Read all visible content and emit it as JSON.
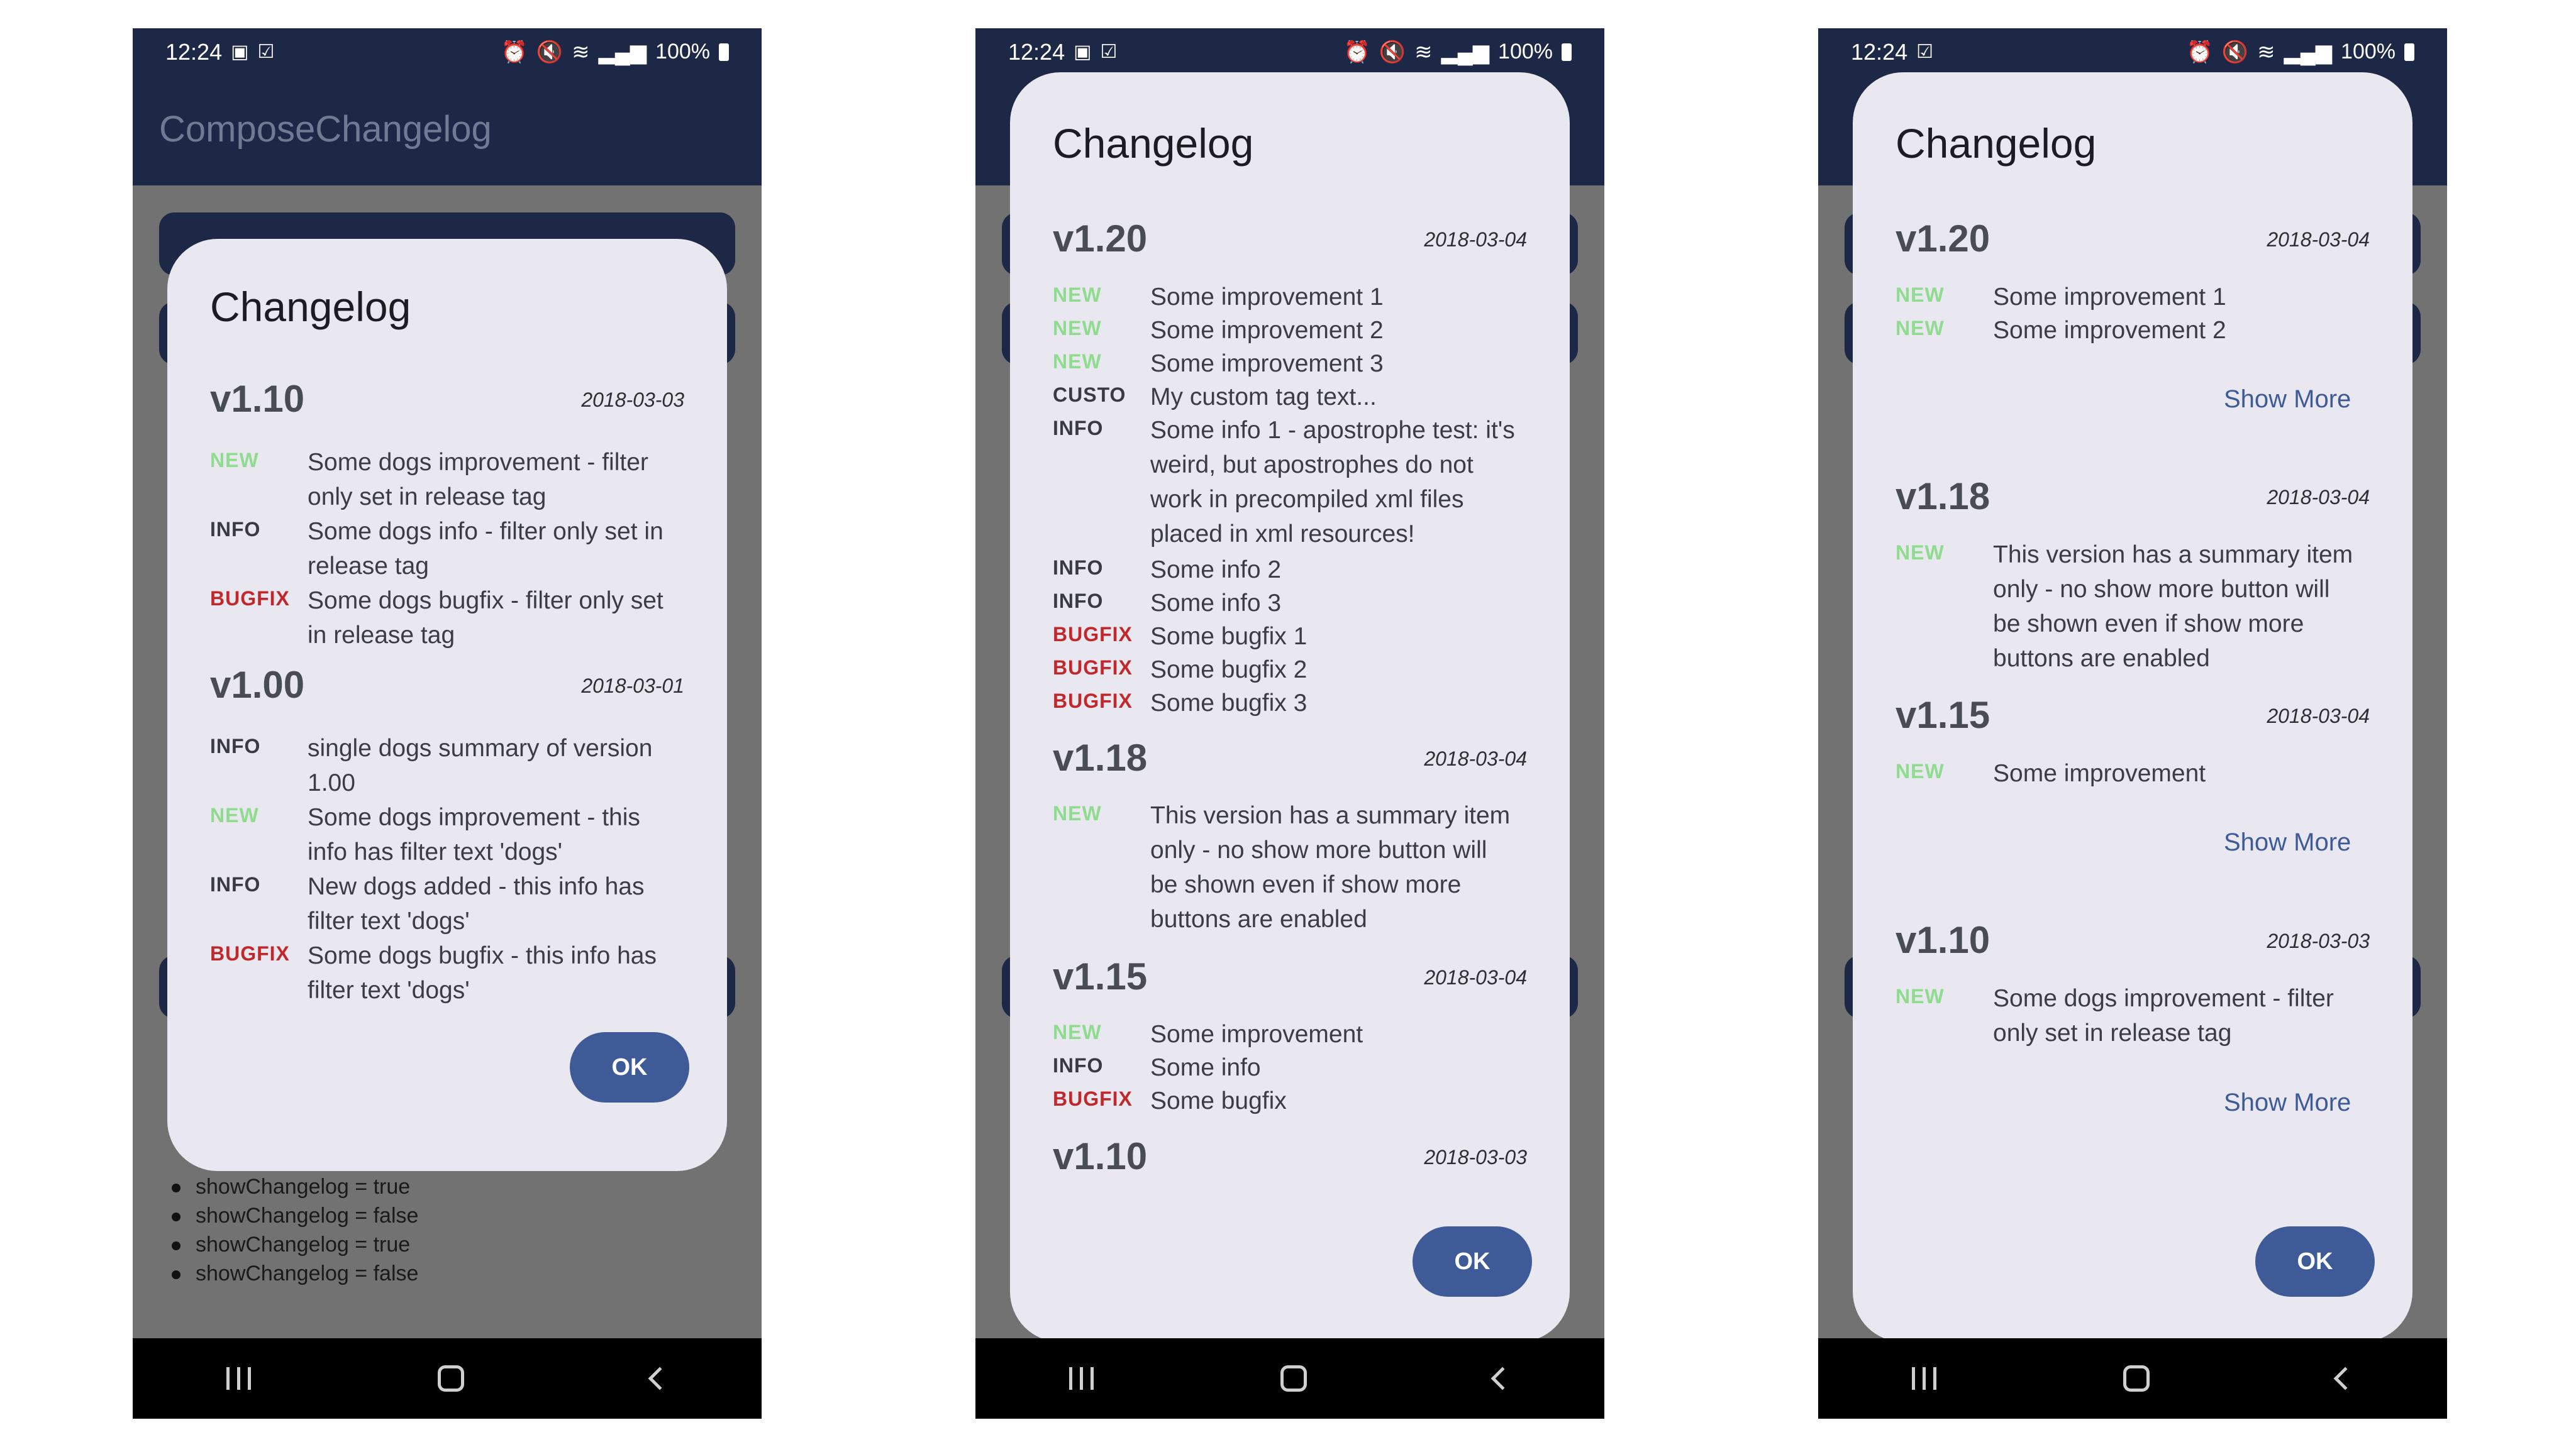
{
  "status": {
    "time": "12:24",
    "battery": "100%"
  },
  "screen1": {
    "app_title": "ComposeChangelog",
    "bg_items": [
      "showChangelog = true",
      "showChangelog = false",
      "showChangelog = true",
      "showChangelog = false"
    ],
    "dialog": {
      "title": "Changelog",
      "versions": [
        {
          "name": "v1.10",
          "date": "2018-03-03",
          "items": [
            {
              "tag": "NEW",
              "line1": "Some dogs improvement - filter",
              "line2": "only set in release tag"
            },
            {
              "tag": "INFO",
              "line1": "Some dogs info - filter only set in",
              "line2": "release tag"
            },
            {
              "tag": "BUGFIX",
              "line1": "Some dogs bugfix - filter only set",
              "line2": "in release tag"
            }
          ]
        },
        {
          "name": "v1.00",
          "date": "2018-03-01",
          "items": [
            {
              "tag": "INFO",
              "line1": "single dogs summary of version",
              "line2": "1.00"
            },
            {
              "tag": "NEW",
              "line1": "Some dogs improvement - this",
              "line2": "info has filter text 'dogs'"
            },
            {
              "tag": "INFO",
              "line1": "New dogs added - this info has",
              "line2": "filter text 'dogs'"
            },
            {
              "tag": "BUGFIX",
              "line1": "Some dogs bugfix - this info has",
              "line2": "filter text 'dogs'"
            }
          ]
        }
      ],
      "ok_label": "OK"
    }
  },
  "screen2": {
    "dialog": {
      "title": "Changelog",
      "v120": {
        "name": "v1.20",
        "date": "2018-03-04",
        "items": [
          {
            "tag": "NEW",
            "text": "Some improvement 1"
          },
          {
            "tag": "NEW",
            "text": "Some improvement 2"
          },
          {
            "tag": "NEW",
            "text": "Some improvement 3"
          },
          {
            "tag": "CUSTO",
            "text": "My custom tag text..."
          },
          {
            "tag": "INFO",
            "line1": "Some info 1 - apostrophe test: it's",
            "line2": "weird, but apostrophes do not",
            "line3": "work in precompiled xml files",
            "line4": "placed in xml resources!"
          },
          {
            "tag": "INFO",
            "text": "Some info 2"
          },
          {
            "tag": "INFO",
            "text": "Some info 3"
          },
          {
            "tag": "BUGFIX",
            "text": "Some bugfix 1"
          },
          {
            "tag": "BUGFIX",
            "text": "Some bugfix 2"
          },
          {
            "tag": "BUGFIX",
            "text": "Some bugfix 3"
          }
        ]
      },
      "v118": {
        "name": "v1.18",
        "date": "2018-03-04",
        "items": [
          {
            "tag": "NEW",
            "line1": "This version has a summary item",
            "line2": "only - no show more button will",
            "line3": "be shown even if show more",
            "line4": "buttons are enabled"
          }
        ]
      },
      "v115": {
        "name": "v1.15",
        "date": "2018-03-04",
        "items": [
          {
            "tag": "NEW",
            "text": "Some improvement"
          },
          {
            "tag": "INFO",
            "text": "Some info"
          },
          {
            "tag": "BUGFIX",
            "text": "Some bugfix"
          }
        ]
      },
      "v110": {
        "name": "v1.10",
        "date": "2018-03-03"
      },
      "ok_label": "OK"
    }
  },
  "screen3": {
    "dialog": {
      "title": "Changelog",
      "v120": {
        "name": "v1.20",
        "date": "2018-03-04",
        "items": [
          {
            "tag": "NEW",
            "text": "Some improvement 1"
          },
          {
            "tag": "NEW",
            "text": "Some improvement 2"
          }
        ]
      },
      "v118": {
        "name": "v1.18",
        "date": "2018-03-04",
        "items": [
          {
            "tag": "NEW",
            "line1": "This version has a summary item",
            "line2": "only - no show more button will",
            "line3": "be shown even if show more",
            "line4": "buttons are enabled"
          }
        ]
      },
      "v115": {
        "name": "v1.15",
        "date": "2018-03-04",
        "items": [
          {
            "tag": "NEW",
            "text": "Some improvement"
          }
        ]
      },
      "v110": {
        "name": "v1.10",
        "date": "2018-03-03",
        "items": [
          {
            "tag": "NEW",
            "line1": "Some dogs improvement - filter",
            "line2": "only set in release tag"
          }
        ]
      },
      "show_more_label": "Show More",
      "ok_label": "OK"
    }
  },
  "colors": {
    "appbar": "#1c2845",
    "scrim": "#727272",
    "dialog": "#e9e8f1",
    "button": "#3e5b97",
    "tag_new": "#8fdc8f",
    "tag_bugfix": "#c0282b"
  },
  "icons": [
    "image-icon",
    "check-box-icon",
    "alarm-icon",
    "mute-icon",
    "wifi-icon",
    "signal-icon",
    "battery-icon",
    "recents-icon",
    "home-icon",
    "back-icon"
  ]
}
